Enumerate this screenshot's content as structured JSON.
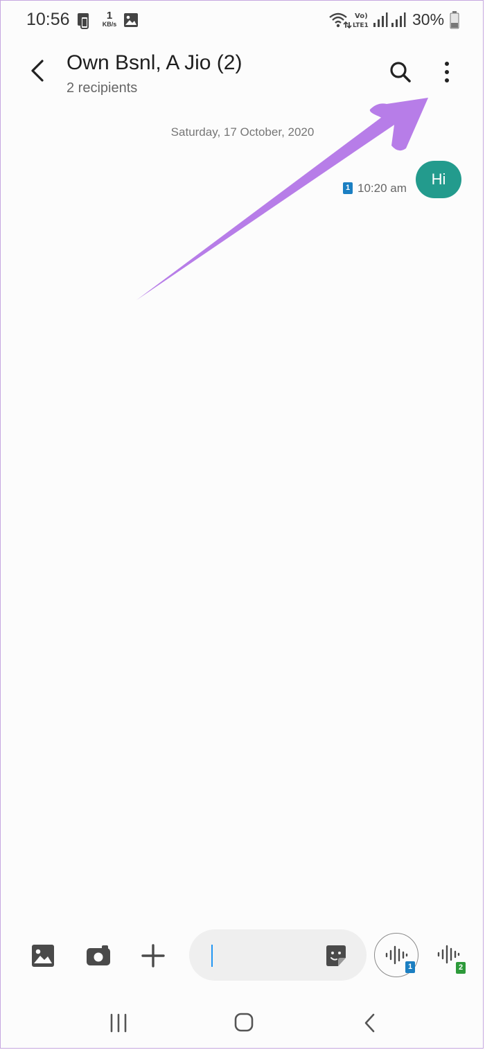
{
  "status_bar": {
    "time": "10:56",
    "net_speed_value": "1",
    "net_speed_unit": "KB/s",
    "battery": "30%"
  },
  "header": {
    "title": "Own Bsnl, A Jio (2)",
    "subtitle": "2 recipients"
  },
  "conversation": {
    "date": "Saturday, 17 October, 2020",
    "messages": [
      {
        "text": "Hi",
        "time": "10:20 am",
        "sim": "1"
      }
    ]
  },
  "composer": {
    "input_value": "",
    "voice_sim_1": "1",
    "voice_sim_2": "2"
  },
  "colors": {
    "bubble": "#239b8d",
    "sim1": "#1b7fc2",
    "sim2": "#2d9a3a",
    "annotation_arrow": "#b77de8"
  }
}
